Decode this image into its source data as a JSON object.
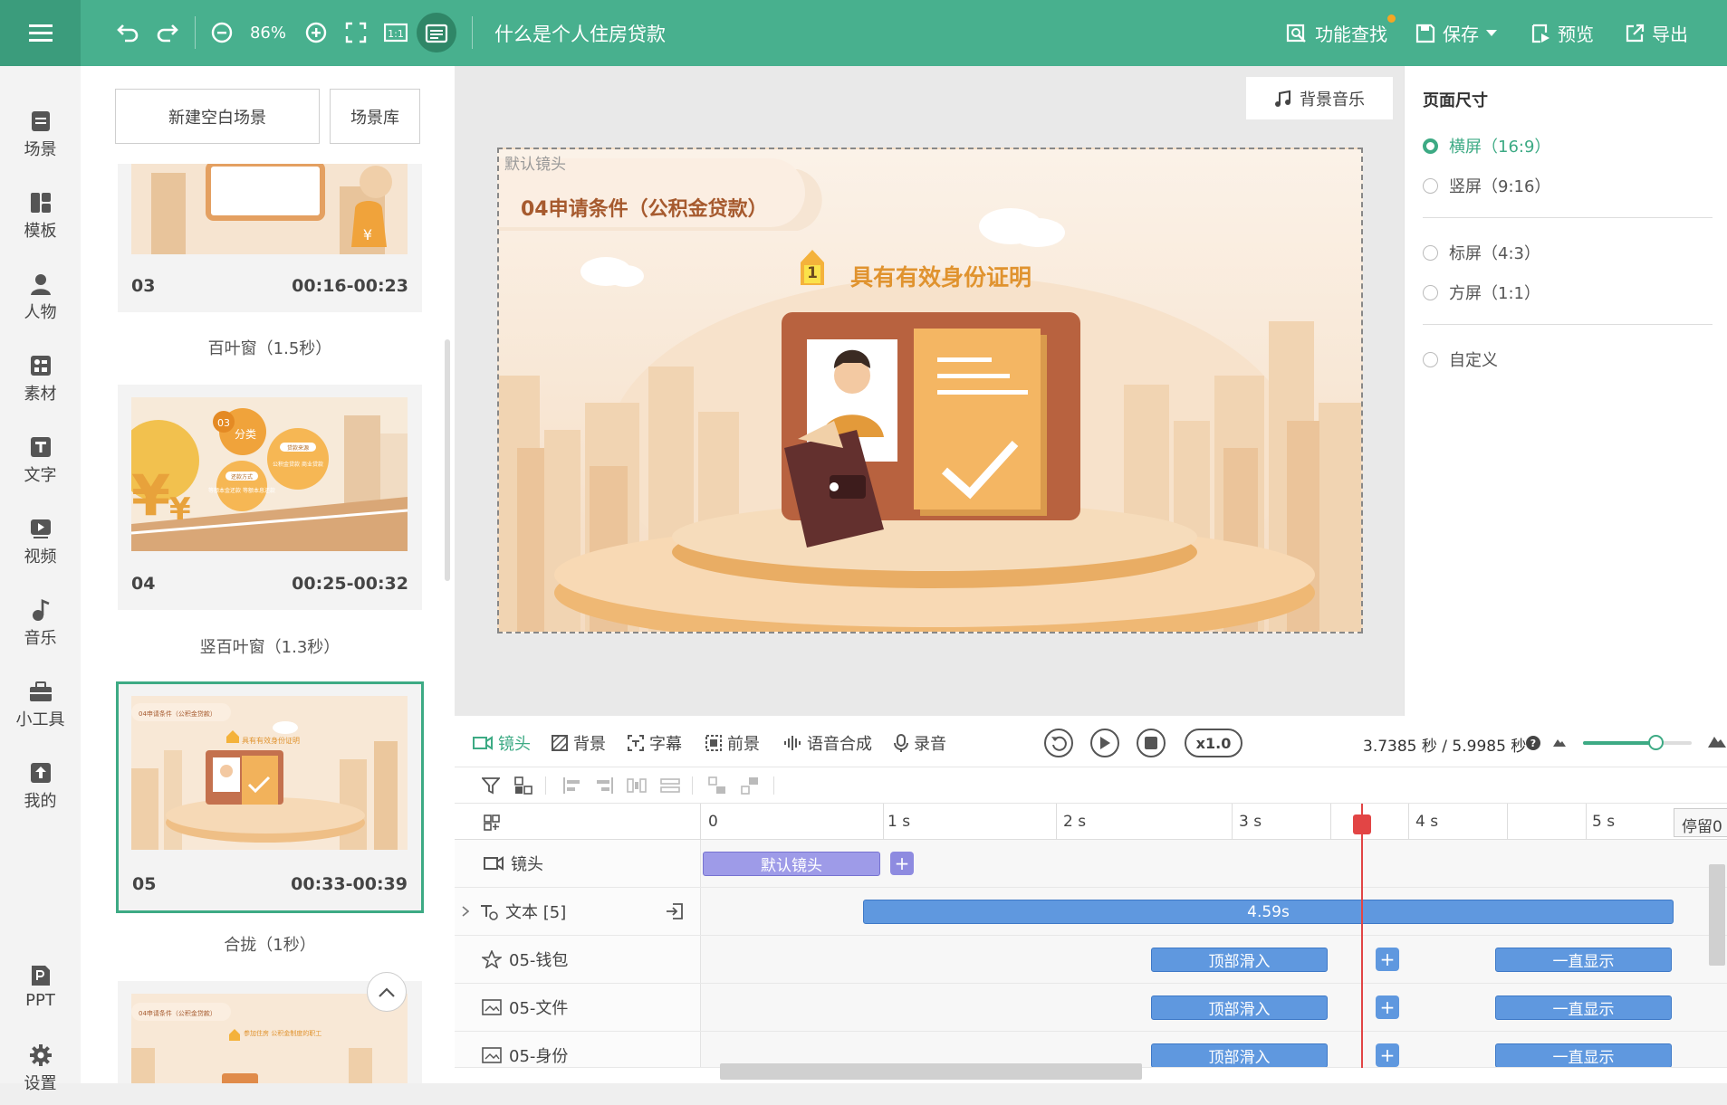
{
  "topbar": {
    "zoom": "86%",
    "doc_title": "什么是个人住房贷款",
    "find": "功能查找",
    "save": "保存",
    "preview": "预览",
    "export": "导出"
  },
  "nav": {
    "items": [
      "场景",
      "模板",
      "人物",
      "素材",
      "文字",
      "视频",
      "音乐",
      "小工具",
      "我的",
      "PPT",
      "设置"
    ]
  },
  "panel": {
    "new_scene": "新建空白场景",
    "library": "场景库",
    "cards": [
      {
        "num": "03",
        "time": "00:16-00:23",
        "transition": "百叶窗（1.5秒）"
      },
      {
        "num": "04",
        "time": "00:25-00:32",
        "transition": "竖百叶窗（1.3秒）"
      },
      {
        "num": "05",
        "time": "00:33-00:39",
        "transition": "合拢（1秒）"
      }
    ],
    "thumb_texts": {
      "t04_badge": "03",
      "t04_tag": "分类",
      "t04_a": "贷款来源",
      "t04_b": "公积金贷款 商业贷款",
      "t04_c": "还款方式",
      "t04_d": "等额本金还款 等额本息还款",
      "t05_title": "04申请条件（公积金贷款）",
      "t05_sub": "具有有效身份证明",
      "t06_title": "04申请条件（公积金贷款）",
      "t06_sub": "参加住房 公积金制度的职工"
    }
  },
  "canvas": {
    "bgm": "背景音乐",
    "cam": "默认镜头",
    "title": "04申请条件（公积金贷款）",
    "badge": "1",
    "subtitle": "具有有效身份证明"
  },
  "props": {
    "title": "页面尺寸",
    "opts": [
      "横屏（16:9）",
      "竖屏（9:16）",
      "标屏（4:3）",
      "方屏（1:1）",
      "自定义"
    ]
  },
  "timeline": {
    "tabs": [
      "镜头",
      "背景",
      "字幕",
      "前景",
      "语音合成",
      "录音"
    ],
    "speed": "x1.0",
    "time": "3.7385 秒 / 5.9985 秒",
    "ticks": [
      "0",
      "1 s",
      "2 s",
      "3 s",
      "4 s",
      "5 s"
    ],
    "stop": "停留0",
    "tracks": {
      "cam": "镜头",
      "cam_clip": "默认镜头",
      "text": "文本 [5]",
      "text_clip": "4.59s",
      "wallet": "05-钱包",
      "file": "05-文件",
      "id": "05-身份",
      "slide": "顶部滑入",
      "always": "一直显示"
    }
  }
}
